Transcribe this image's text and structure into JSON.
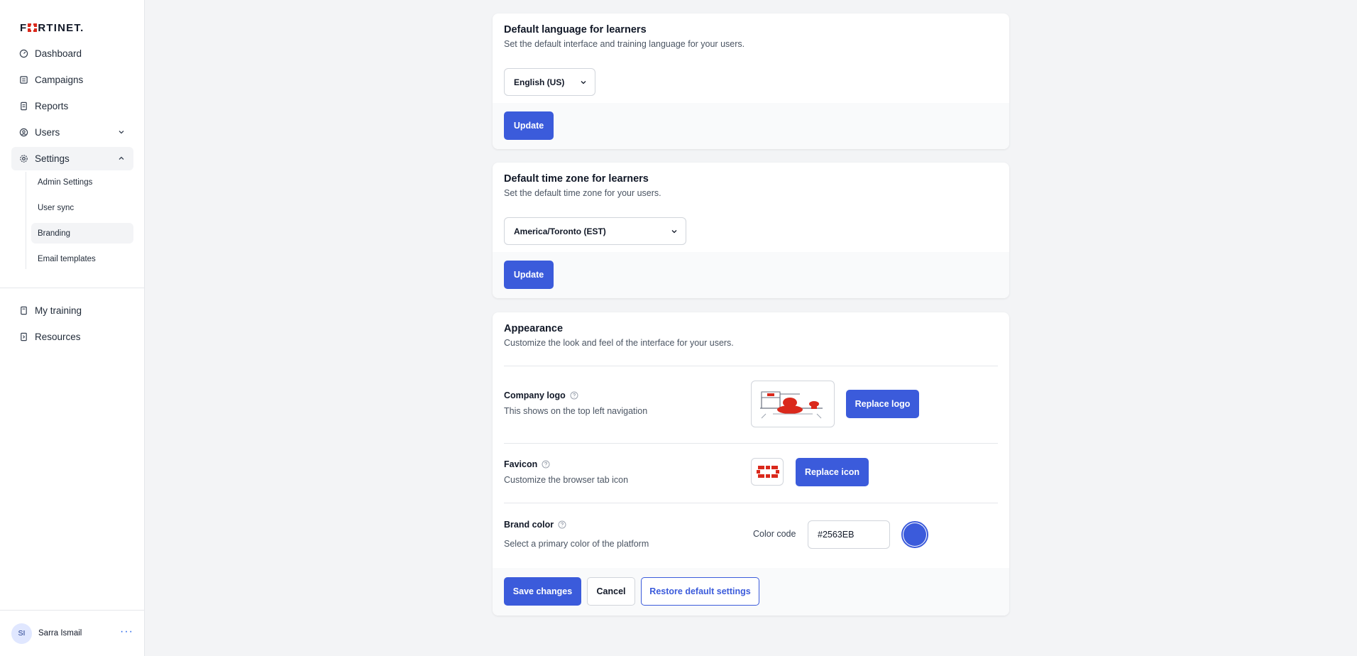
{
  "brand": {
    "logo_text_left": "F",
    "logo_text_right": "RTINET."
  },
  "sidebar": {
    "items": [
      {
        "label": "Dashboard",
        "icon": "gauge-icon"
      },
      {
        "label": "Campaigns",
        "icon": "campaign-icon"
      },
      {
        "label": "Reports",
        "icon": "reports-icon"
      },
      {
        "label": "Users",
        "icon": "user-circle-icon"
      },
      {
        "label": "Settings",
        "icon": "gear-icon"
      }
    ],
    "settings_sub": [
      {
        "label": "Admin Settings"
      },
      {
        "label": "User sync"
      },
      {
        "label": "Branding"
      },
      {
        "label": "Email templates"
      }
    ],
    "bottom_items": [
      {
        "label": "My training",
        "icon": "book-icon"
      },
      {
        "label": "Resources",
        "icon": "resources-icon"
      }
    ],
    "user": {
      "initials": "SI",
      "name": "Sarra Ismail",
      "more": "···"
    }
  },
  "language_card": {
    "title": "Default language for learners",
    "description": "Set the default interface and training language for your users.",
    "selected": "English (US)",
    "button": "Update"
  },
  "timezone_card": {
    "title": "Default time zone for learners",
    "description": "Set the default time zone for your users.",
    "selected": "America/Toronto (EST)",
    "button": "Update"
  },
  "appearance_card": {
    "title": "Appearance",
    "description": "Customize the look and feel of the interface for your users.",
    "company_logo": {
      "title": "Company logo",
      "description": "This shows on the top left navigation",
      "button": "Replace logo"
    },
    "favicon": {
      "title": "Favicon",
      "description": "Customize the browser tab icon",
      "button": "Replace icon"
    },
    "brand_color": {
      "title": "Brand color",
      "description": "Select a primary color of the platform",
      "color_label": "Color code",
      "value": "#2563EB"
    },
    "footer": {
      "save": "Save changes",
      "cancel": "Cancel",
      "restore": "Restore default settings"
    }
  },
  "colors": {
    "accent": "#3b5bdb",
    "fortinet_red": "#da291c",
    "swatch": "#3b5bdb"
  }
}
